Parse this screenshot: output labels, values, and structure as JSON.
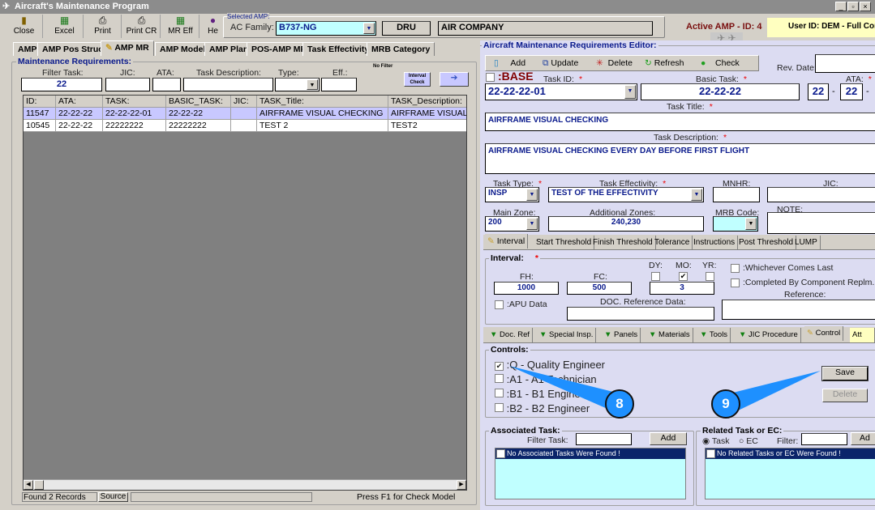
{
  "window": {
    "title": "Aircraft's Maintenance Program",
    "min": "_",
    "restore": "▫",
    "close": "×"
  },
  "toolbar": [
    {
      "label": "Close",
      "icon": "door-exit-icon"
    },
    {
      "label": "Excel",
      "icon": "excel-icon"
    },
    {
      "label": "Print",
      "icon": "printer-icon"
    },
    {
      "label": "Print CR",
      "icon": "printer-icon"
    },
    {
      "label": "MR Eff",
      "icon": "excel-icon"
    },
    {
      "label": "He",
      "icon": "help-icon"
    }
  ],
  "selected_amp": {
    "title": "Selected AMP:",
    "ac_family_label": "AC Family:",
    "ac_family": "B737-NG",
    "code": "DRU",
    "company": "AIR COMPANY"
  },
  "active_amp": "Active AMP - ID: 4",
  "user": "User ID: DEM - Full Con",
  "tabs": [
    "AMP",
    "AMP Pos Struct",
    "AMP MR",
    "AMP Model",
    "AMP Plan",
    "POS-AMP MR",
    "Task Effectivity",
    "MRB Category"
  ],
  "left": {
    "title": "Maintenance Requirements:",
    "no_filter": "No Filter",
    "filters": {
      "task_label": "Filter Task:",
      "task": "22",
      "jic_label": "JIC:",
      "ata_label": "ATA:",
      "desc_label": "Task Description:",
      "type_label": "Type:",
      "eff_label": "Eff.:"
    },
    "interval_check": "Interval Check",
    "columns": [
      "ID:",
      "ATA:",
      "TASK:",
      "BASIC_TASK:",
      "JIC:",
      "TASK_Title:",
      "TASK_Description:"
    ],
    "rows": [
      [
        "11547",
        "22-22-22",
        "22-22-22-01",
        "22-22-22",
        "",
        "AIRFRAME VISUAL CHECKING",
        "AIRFRAME VISUAL C"
      ],
      [
        "10545",
        "22-22-22",
        "22222222",
        "22222222",
        "",
        "TEST 2",
        "TEST2"
      ]
    ],
    "status": {
      "found": "Found 2 Records",
      "source": "Source",
      "hint": "Press F1 for Check Model"
    }
  },
  "editor": {
    "title": "Aircraft Maintenance Requirements Editor:",
    "actions": [
      "Add",
      "Update",
      "Delete",
      "Refresh",
      "Check"
    ],
    "rev_date_label": "Rev. Date:",
    "base": ":BASE",
    "task_id_label": "Task ID:",
    "task_id": "22-22-22-01",
    "basic_task_label": "Basic Task:",
    "basic_task": "22-22-22",
    "ata_label": "ATA:",
    "ata1": "22",
    "ata2": "22",
    "task_title_label": "Task Title:",
    "task_title": "AIRFRAME VISUAL CHECKING",
    "task_desc_label": "Task Description:",
    "task_desc": "AIRFRAME VISUAL CHECKING EVERY DAY BEFORE FIRST FLIGHT",
    "task_type_label": "Task Type:",
    "task_type": "INSP",
    "task_eff_label": "Task Effectivity:",
    "task_eff": "TEST OF THE EFFECTIVITY",
    "mnhr_label": "MNHR:",
    "jic_label": "JIC:",
    "main_zone_label": "Main Zone:",
    "main_zone": "200",
    "add_zones_label": "Additional Zones:",
    "add_zones": "240,230",
    "mrb_label": "MRB Code:",
    "note_label": "NOTE:",
    "subtabs": [
      "Interval",
      "Start Threshold",
      "Finish Threshold",
      "Tolerance",
      "Instructions",
      "Post Threshold",
      "LUMP"
    ],
    "interval": {
      "title": "Interval:",
      "fh_label": "FH:",
      "fh": "1000",
      "fc_label": "FC:",
      "fc": "500",
      "dy": "DY:",
      "mo": "MO:",
      "yr": "YR:",
      "mo_checked": true,
      "period": "3",
      "apu": ":APU Data",
      "doc_ref": "DOC. Reference Data:",
      "whichever": ":Whichever Comes Last",
      "completed": ":Completed By Component Replm.",
      "reference": "Reference:"
    },
    "tabs2": [
      "Doc. Ref",
      "Special Insp.",
      "Panels",
      "Materials",
      "Tools",
      "JIC Procedure",
      "Control",
      "Att"
    ],
    "controls": {
      "title": "Controls:",
      "items": [
        {
          "label": ":Q - Quality Engineer",
          "checked": true
        },
        {
          "label": ":A1 - A1 Technician",
          "checked": false
        },
        {
          "label": ":B1 - B1 Engineer",
          "checked": false
        },
        {
          "label": ":B2 - B2 Engineer",
          "checked": false
        }
      ],
      "save": "Save",
      "delete": "Delete"
    },
    "associated": {
      "title": "Associated Task:",
      "filter_label": "Filter Task:",
      "add": "Add",
      "empty": "No Associated Tasks Were Found !"
    },
    "related": {
      "title": "Related Task or EC:",
      "task": "Task",
      "ec": "EC",
      "filter_label": "Filter:",
      "add": "Ad",
      "empty": "No Related Tasks or EC Were Found !"
    }
  },
  "callouts": [
    "8",
    "9"
  ],
  "colors": {
    "callout": "#1e90ff",
    "selection": "#0a246a",
    "list_bg": "#c0ffff",
    "panel": "#dcdcf2"
  }
}
